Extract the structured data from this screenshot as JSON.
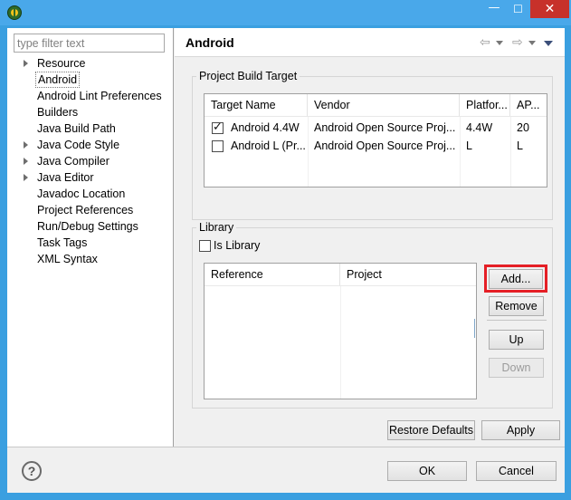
{
  "filter": {
    "placeholder": "type filter text"
  },
  "tree": [
    {
      "label": "Resource",
      "expandable": true
    },
    {
      "label": "Android",
      "expandable": false,
      "selected": true
    },
    {
      "label": "Android Lint Preferences",
      "expandable": false
    },
    {
      "label": "Builders",
      "expandable": false
    },
    {
      "label": "Java Build Path",
      "expandable": false
    },
    {
      "label": "Java Code Style",
      "expandable": true
    },
    {
      "label": "Java Compiler",
      "expandable": true
    },
    {
      "label": "Java Editor",
      "expandable": true
    },
    {
      "label": "Javadoc Location",
      "expandable": false
    },
    {
      "label": "Project References",
      "expandable": false
    },
    {
      "label": "Run/Debug Settings",
      "expandable": false
    },
    {
      "label": "Task Tags",
      "expandable": false
    },
    {
      "label": "XML Syntax",
      "expandable": false
    }
  ],
  "page": {
    "title": "Android",
    "nav_back": "⇦",
    "nav_forward": "⇨"
  },
  "build_target": {
    "legend": "Project Build Target",
    "columns": [
      "Target Name",
      "Vendor",
      "Platfor...",
      "AP..."
    ],
    "rows": [
      {
        "checked": true,
        "name": "Android 4.4W",
        "vendor": "Android Open Source Proj...",
        "platform": "4.4W",
        "api": "20"
      },
      {
        "checked": false,
        "name": "Android L (Pr...",
        "vendor": "Android Open Source Proj...",
        "platform": "L",
        "api": "L"
      }
    ]
  },
  "library": {
    "legend": "Library",
    "is_library_label": "Is Library",
    "is_library_checked": false,
    "columns": [
      "Reference",
      "Project"
    ],
    "buttons": {
      "add": "Add...",
      "remove": "Remove",
      "up": "Up",
      "down": "Down"
    }
  },
  "footer": {
    "restore_defaults": "Restore Defaults",
    "apply": "Apply",
    "ok": "OK",
    "cancel": "Cancel",
    "help": "?"
  },
  "colors": {
    "highlight": "#e51f26",
    "title_bar": "#49a8ea",
    "close_button": "#c7312a"
  }
}
